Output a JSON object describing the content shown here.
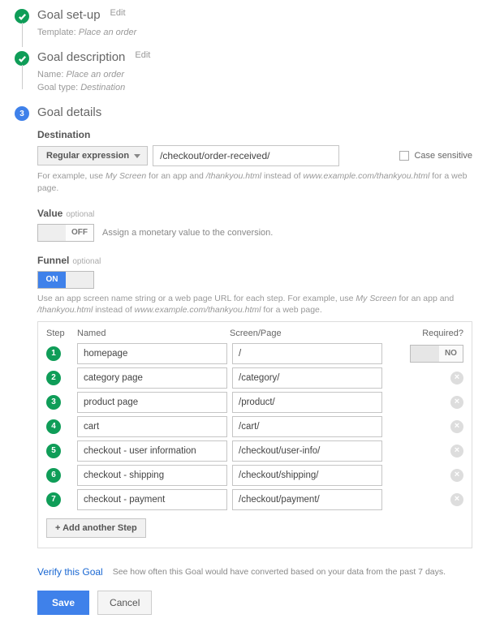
{
  "steps": {
    "setup": {
      "title": "Goal set-up",
      "edit": "Edit",
      "sub_label": "Template:",
      "sub_value": "Place an order"
    },
    "description": {
      "title": "Goal description",
      "edit": "Edit",
      "name_label": "Name:",
      "name_value": "Place an order",
      "type_label": "Goal type:",
      "type_value": "Destination"
    },
    "details": {
      "number": "3",
      "title": "Goal details"
    }
  },
  "destination": {
    "label": "Destination",
    "match_type": "Regular expression",
    "value": "/checkout/order-received/",
    "case_sensitive": "Case sensitive",
    "help_pre": "For example, use ",
    "help_i1": "My Screen",
    "help_mid1": " for an app and ",
    "help_i2": "/thankyou.html",
    "help_mid2": " instead of ",
    "help_i3": "www.example.com/thankyou.html",
    "help_post": " for a web page."
  },
  "value": {
    "label": "Value",
    "optional": "optional",
    "off": "OFF",
    "help": "Assign a monetary value to the conversion."
  },
  "funnel": {
    "label": "Funnel",
    "optional": "optional",
    "on": "ON",
    "help_pre": "Use an app screen name string or a web page URL for each step. For example, use ",
    "help_i1": "My Screen",
    "help_mid1": " for an app and ",
    "help_i2": "/thankyou.html",
    "help_mid2": " instead of ",
    "help_i3": "www.example.com/thankyou.html",
    "help_post": " for a web page.",
    "head_step": "Step",
    "head_name": "Named",
    "head_screen": "Screen/Page",
    "head_required": "Required?",
    "required_no": "NO",
    "add": "+ Add another Step",
    "rows": [
      {
        "n": "1",
        "name": "homepage",
        "screen": "/"
      },
      {
        "n": "2",
        "name": "category page",
        "screen": "/category/"
      },
      {
        "n": "3",
        "name": "product page",
        "screen": "/product/"
      },
      {
        "n": "4",
        "name": "cart",
        "screen": "/cart/"
      },
      {
        "n": "5",
        "name": "checkout - user information",
        "screen": "/checkout/user-info/"
      },
      {
        "n": "6",
        "name": "checkout - shipping",
        "screen": "/checkout/shipping/"
      },
      {
        "n": "7",
        "name": "checkout - payment",
        "screen": "/checkout/payment/"
      }
    ]
  },
  "verify": {
    "link": "Verify this Goal",
    "text": "See how often this Goal would have converted based on your data from the past 7 days."
  },
  "buttons": {
    "save": "Save",
    "cancel": "Cancel"
  }
}
